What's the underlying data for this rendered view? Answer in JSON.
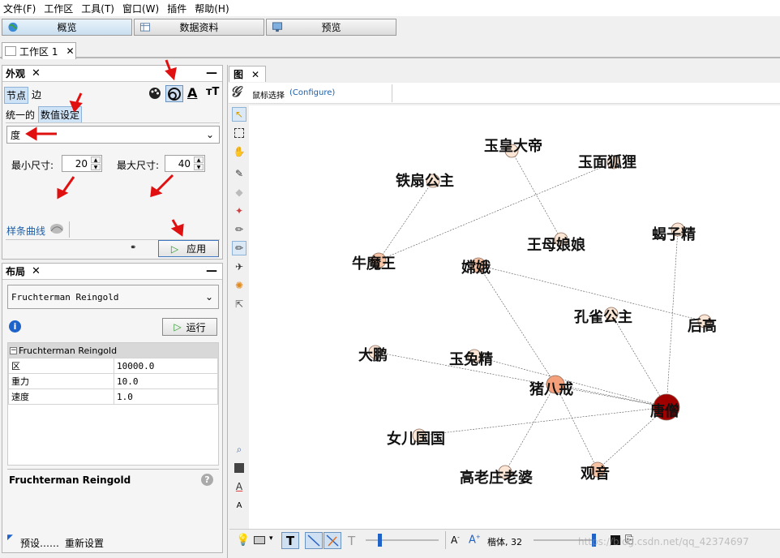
{
  "menu": [
    "文件(F)",
    "工作区",
    "工具(T)",
    "窗口(W)",
    "插件",
    "帮助(H)"
  ],
  "top_tabs": [
    {
      "label": "概览",
      "icon": "globe-icon"
    },
    {
      "label": "数据资料",
      "icon": "table-icon"
    },
    {
      "label": "预览",
      "icon": "monitor-icon"
    }
  ],
  "workspace_tab": "工作区 1",
  "appearance": {
    "title": "外观",
    "tab_nodes": "节点",
    "tab_edges": "边",
    "sub_unique": "统一的",
    "sub_ranking": "数值设定",
    "attribute": "度",
    "min_label": "最小尺寸:",
    "min_value": "20",
    "max_label": "最大尺寸:",
    "max_value": "40",
    "spline": "样条曲线",
    "apply": "应用"
  },
  "layout": {
    "title": "布局",
    "algorithm": "Fruchterman Reingold",
    "run": "运行",
    "section": "Fruchterman Reingold",
    "props": [
      {
        "name": "区",
        "value": "10000.0"
      },
      {
        "name": "重力",
        "value": "10.0"
      },
      {
        "name": "速度",
        "value": "1.0"
      }
    ],
    "desc_title": "Fruchterman Reingold",
    "presets": "预设……",
    "reset": "重新设置"
  },
  "graph_panel": {
    "tab": "图",
    "mouse_select": "鼠标选择",
    "configure": "(Configure)"
  },
  "graph": {
    "nodes": [
      {
        "id": "玉皇大帝",
        "faded": true
      },
      {
        "id": "玉面狐狸"
      },
      {
        "id": "铁扇公主"
      },
      {
        "id": "王母娘娘"
      },
      {
        "id": "蝎子精"
      },
      {
        "id": "牛魔王"
      },
      {
        "id": "嫦娥"
      },
      {
        "id": "孔雀公主"
      },
      {
        "id": "后高"
      },
      {
        "id": "大鹏"
      },
      {
        "id": "玉兔精"
      },
      {
        "id": "猪八戒"
      },
      {
        "id": "唐僧"
      },
      {
        "id": "女儿国国"
      },
      {
        "id": "高老庄老婆"
      },
      {
        "id": "观音"
      }
    ],
    "edges": [
      [
        "玉皇大帝",
        "王母娘娘"
      ],
      [
        "玉面狐狸",
        "牛魔王"
      ],
      [
        "铁扇公主",
        "牛魔王"
      ],
      [
        "嫦娥",
        "后高"
      ],
      [
        "嫦娥",
        "猪八戒"
      ],
      [
        "蝎子精",
        "唐僧"
      ],
      [
        "孔雀公主",
        "唐僧"
      ],
      [
        "大鹏",
        "唐僧"
      ],
      [
        "玉兔精",
        "唐僧"
      ],
      [
        "猪八戒",
        "唐僧"
      ],
      [
        "女儿国国",
        "唐僧"
      ],
      [
        "猪八戒",
        "高老庄老婆"
      ],
      [
        "猪八戒",
        "观音"
      ],
      [
        "观音",
        "唐僧"
      ]
    ]
  },
  "bottom_toolbar": {
    "font": "楷体, 32"
  },
  "watermark": "https://blog.csdn.net/qq_42374697",
  "colors": {
    "accent": "#1c5ea8",
    "node_dark": "#a00000",
    "node_mid": "#f4a07a",
    "node_light": "#fbe6d6"
  }
}
